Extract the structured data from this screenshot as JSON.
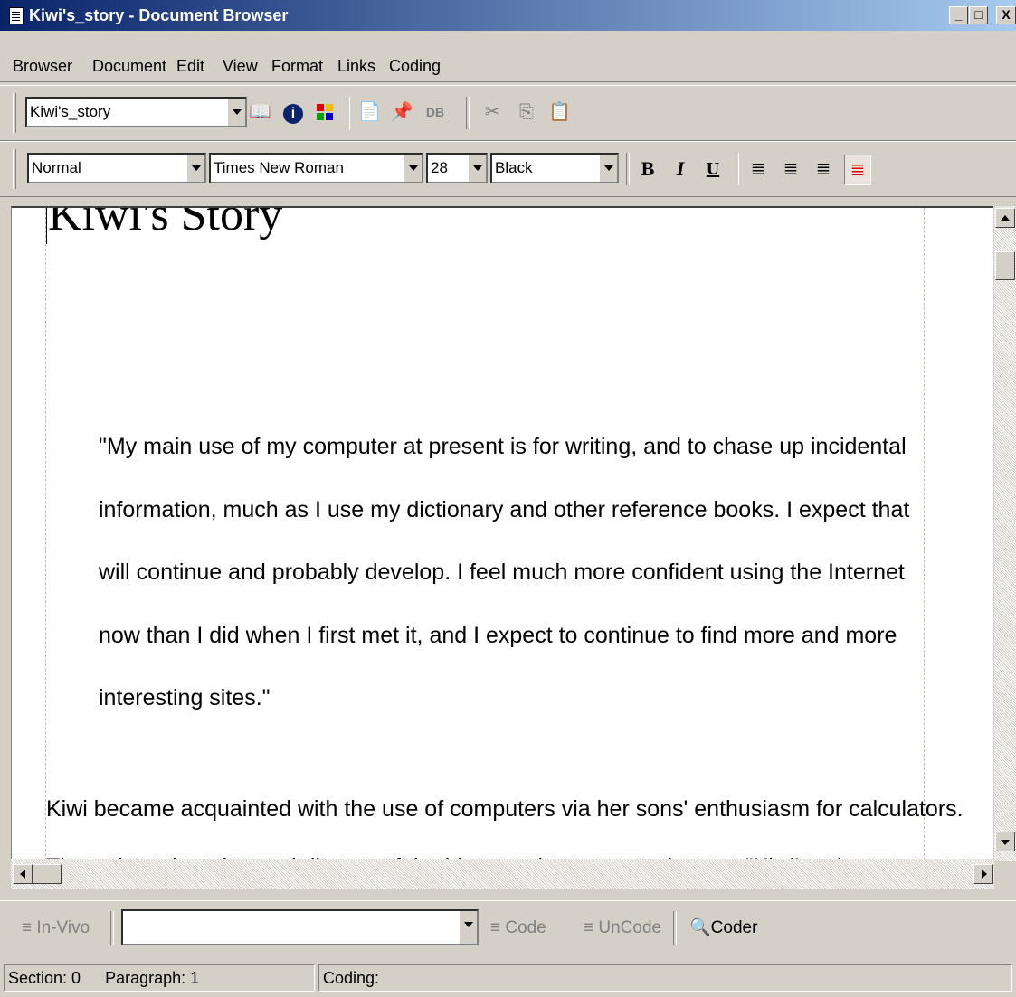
{
  "window": {
    "title": "Kiwi's_story - Document Browser",
    "minimize": "_",
    "maximize": "□",
    "close": "X"
  },
  "menu": [
    "Browser",
    "Document",
    "Edit",
    "View",
    "Format",
    "Links",
    "Coding"
  ],
  "toolbar1": {
    "document_select": "Kiwi's_story",
    "db_label": "DB"
  },
  "toolbar2": {
    "style": "Normal",
    "font": "Times New Roman",
    "size": "28",
    "color": "Black",
    "bold": "B",
    "italic": "I",
    "underline": "U"
  },
  "document": {
    "title": "Kiwi's Story",
    "quote_lines": [
      "\"My main use of my computer at present is for writing, and to chase up incidental",
      "information, much as I use my dictionary and other reference books. I expect that",
      "will continue and probably develop. I feel much more confident using the Internet",
      "now than I did when I first met it, and I expect to continue to find more and more",
      "interesting sites.\""
    ],
    "paragraph": "Kiwi became acquainted with the use of computers via her sons' enthusiasm for calculators.",
    "cut_line": "Through exchanging and dispute of the ideas and many experiences, \"Kiwi's relat"
  },
  "coding_bar": {
    "invivo": "In-Vivo",
    "code": "Code",
    "uncode": "UnCode",
    "coder": "Coder",
    "node_value": ""
  },
  "status": {
    "section": "Section: 0",
    "paragraph": "Paragraph: 1",
    "coding": "Coding:"
  }
}
